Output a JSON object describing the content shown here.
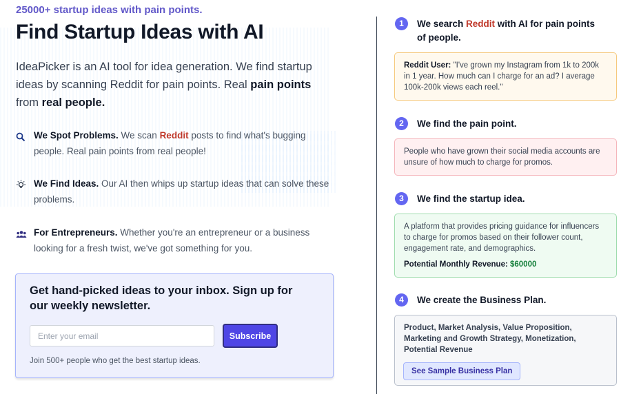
{
  "hero": {
    "eyebrow": "25000+ startup ideas with pain points.",
    "title": "Find Startup Ideas with AI",
    "intro_1": "IdeaPicker is an AI tool for idea generation. We find startup ideas by scanning Reddit for pain points. Real ",
    "intro_bold_1": "pain points",
    "intro_2": " from ",
    "intro_bold_2": "real people."
  },
  "features": [
    {
      "icon": "search-icon",
      "title": "We Spot Problems.",
      "text_1": " We scan ",
      "highlight": "Reddit",
      "text_2": " posts to find what's bugging people. Real pain points from real people!"
    },
    {
      "icon": "lightbulb-icon",
      "title": "We Find Ideas.",
      "text_1": " Our AI then whips up startup ideas that can solve these problems."
    },
    {
      "icon": "users-icon",
      "title": "For Entrepreneurs.",
      "text_1": " Whether you're an entrepreneur or a business looking for a fresh twist, we've got something for you."
    }
  ],
  "newsletter": {
    "title": "Get hand-picked ideas to your inbox. Sign up for our weekly newsletter.",
    "email_placeholder": "Enter your email",
    "email_value": "",
    "subscribe_label": "Subscribe",
    "note": "Join 500+ people who get the best startup ideas."
  },
  "steps": [
    {
      "number": "1",
      "title_1": "We search ",
      "title_highlight": "Reddit",
      "title_2": " with AI for pain points of people."
    },
    {
      "number": "2",
      "title": "We find the pain point."
    },
    {
      "number": "3",
      "title": "We find the startup idea."
    },
    {
      "number": "4",
      "title": "We create the Business Plan."
    }
  ],
  "cards": {
    "reddit_post": {
      "author": "Reddit User:",
      "quote": " \"I've grown my Instagram from 1k to 200k in 1 year. How much can I charge for an ad? I average 100k-200k views each reel.\""
    },
    "pain_point": "People who have grown their social media accounts are unsure of how much to charge for promos.",
    "idea": {
      "text": "A platform that provides pricing guidance for influencers to charge for promos based on their follower count, engagement rate, and demographics.",
      "revenue_label": "Potential Monthly Revenue: ",
      "revenue_value": "$60000"
    },
    "plan": {
      "sections": "Product, Market Analysis, Value Proposition, Marketing and Growth Strategy, Monetization, Potential Revenue",
      "button_label": "See Sample Business Plan"
    }
  },
  "colors": {
    "accent": "#6366f1",
    "eyebrow": "#6259c9",
    "reddit": "#c0392b",
    "revenue": "#16803c"
  }
}
